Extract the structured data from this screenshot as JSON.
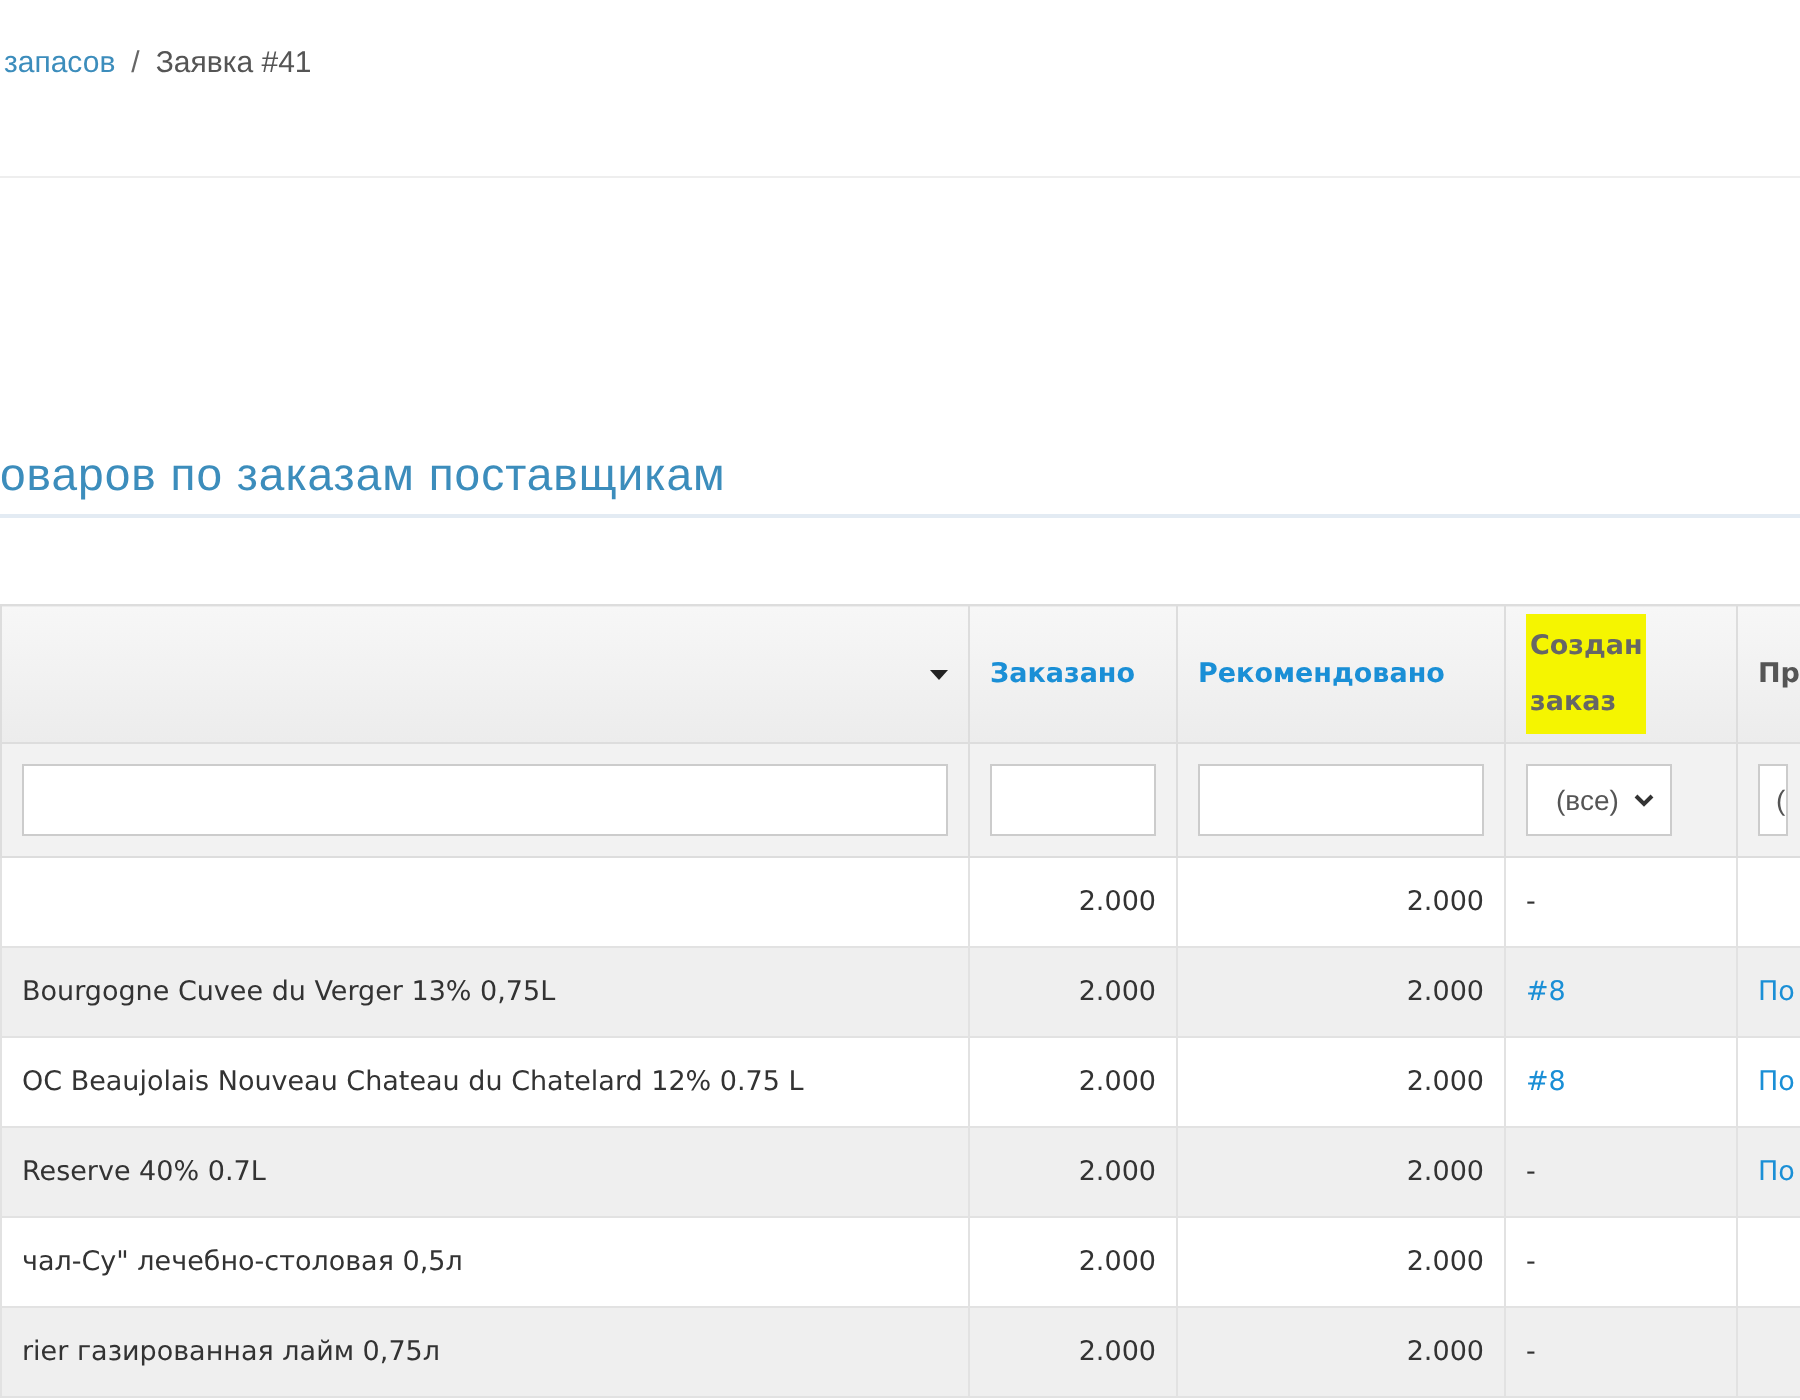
{
  "breadcrumb": [
    {
      "label": "запасов",
      "kind": "link"
    },
    {
      "label": "Заявка #41",
      "kind": "current"
    }
  ],
  "breadcrumb_separator": "/",
  "section_title": "оваров по заказам поставщикам",
  "table": {
    "columns": [
      {
        "filter": {
          "kind": "text"
        },
        "highlighted": false
      },
      {
        "label": "Заказано",
        "filter": {
          "kind": "text"
        },
        "highlighted": false,
        "link": true
      },
      {
        "label": "Рекомендовано",
        "filter": {
          "kind": "text"
        },
        "highlighted": false,
        "link": true
      },
      {
        "label": "Создан заказ",
        "filter": {
          "kind": "select",
          "value": "(все)"
        },
        "highlighted": true,
        "link": false
      },
      {
        "label": "Пр",
        "filter": {
          "kind": "select_cut",
          "value": "("
        },
        "highlighted": false,
        "link": false
      }
    ],
    "rows": [
      {
        "name": "",
        "ordered": "2.000",
        "recommended": "2.000",
        "order": "-",
        "order_link": false,
        "column_5": ""
      },
      {
        "name": "Bourgogne Cuvee du Verger 13% 0,75L",
        "ordered": "2.000",
        "recommended": "2.000",
        "order": "#8",
        "order_link": true,
        "column_5": "По"
      },
      {
        "name": "OC Beaujolais Nouveau Chateau du Chatelard 12% 0.75 L",
        "ordered": "2.000",
        "recommended": "2.000",
        "order": "#8",
        "order_link": true,
        "column_5": "По"
      },
      {
        "name": "Reserve 40% 0.7L",
        "ordered": "2.000",
        "recommended": "2.000",
        "order": "-",
        "order_link": false,
        "column_5": "По"
      },
      {
        "name": "чал-Су\" лечебно-столовая 0,5л",
        "ordered": "2.000",
        "recommended": "2.000",
        "order": "-",
        "order_link": false,
        "column_5": ""
      },
      {
        "name": "rier газированная лайм 0,75л",
        "ordered": "2.000",
        "recommended": "2.000",
        "order": "-",
        "order_link": false,
        "column_5": ""
      }
    ]
  }
}
